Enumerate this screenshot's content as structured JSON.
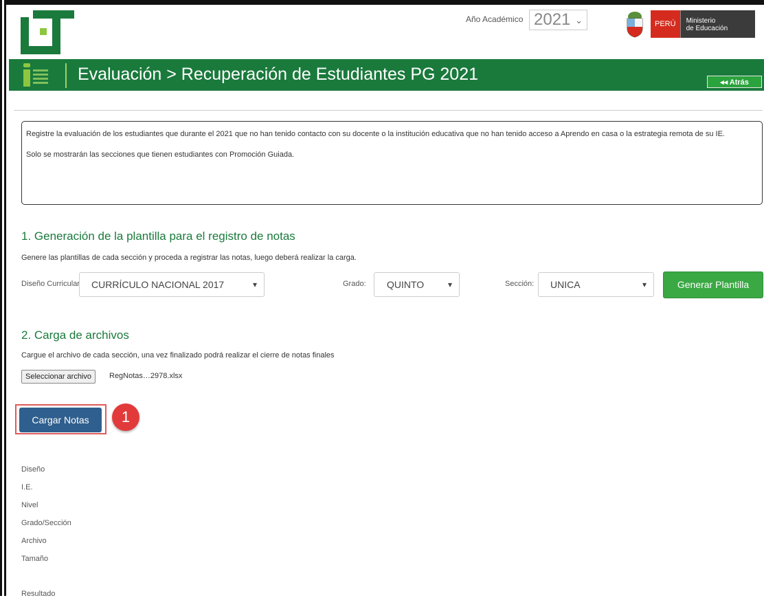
{
  "header": {
    "year_label": "Año Académico",
    "year_value": "2021",
    "gov_peru": "PERÚ",
    "gov_ministry_line1": "Ministerio",
    "gov_ministry_line2": "de Educación"
  },
  "title_bar": {
    "title": "Evaluación > Recuperación de Estudiantes PG 2021",
    "back_label": "Atrás",
    "color": "#1a7a3c"
  },
  "info": {
    "paragraph1": "Registre la evaluación de los estudiantes que durante el 2021 que no han tenido contacto con su docente o la institución educativa que no han tenido acceso a Aprendo en casa o la estrategia remota de su IE.",
    "paragraph2": "Solo se mostrarán las secciones que tienen estudiantes con Promoción Guiada."
  },
  "section1": {
    "title": "1. Generación de la plantilla para el registro de notas",
    "description": "Genere las plantillas de cada sección y proceda a registrar las notas, luego deberá realizar la carga.",
    "curricular_label": "Diseño Curricular:",
    "curricular_value": "CURRÍCULO NACIONAL 2017",
    "grado_label": "Grado:",
    "grado_value": "QUINTO",
    "seccion_label": "Sección:",
    "seccion_value": "UNICA",
    "generate_button": "Generar Plantilla"
  },
  "section2": {
    "title": "2. Carga de archivos",
    "description": "Cargue el archivo de cada sección, una vez finalizado podrá realizar el cierre de notas finales",
    "file_button": "Seleccionar archivo",
    "file_name": "RegNotas…2978.xlsx",
    "upload_button": "Cargar Notas",
    "step_badge": "1"
  },
  "details": {
    "labels": [
      "Diseño",
      "I.E.",
      "Nivel",
      "Grado/Sección",
      "Archivo",
      "Tamaño"
    ],
    "result_label": "Resultado"
  }
}
